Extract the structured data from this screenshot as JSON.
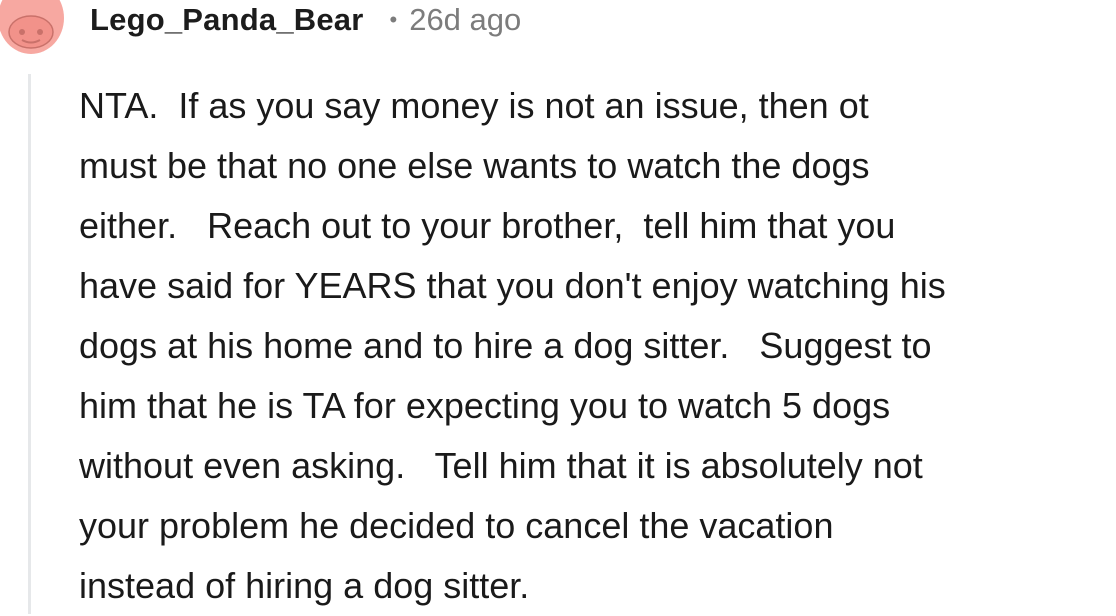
{
  "comment": {
    "author": "Lego_Panda_Bear",
    "separator": "•",
    "timestamp": "26d ago",
    "avatar_icon": "snoo-avatar-icon",
    "avatar_color": "#f7a8a1",
    "body_lines": [
      "NTA.  If as you say money is not an issue, then ot",
      "must be that no one else wants to watch the dogs",
      "either.   Reach out to your brother,  tell him that you",
      "have said for YEARS that you don't enjoy watching his",
      "dogs at his home and to hire a dog sitter.   Suggest to",
      "him that he is TA for expecting you to watch 5 dogs",
      "without even asking.   Tell him that it is absolutely not",
      "your problem he decided to cancel the vacation",
      "instead of hiring a dog sitter."
    ]
  }
}
